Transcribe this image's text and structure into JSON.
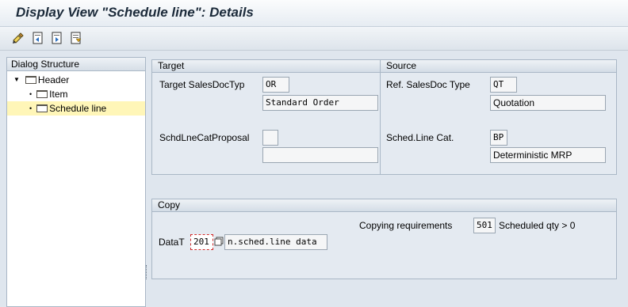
{
  "window": {
    "title": "Display View \"Schedule line\": Details"
  },
  "toolbar": {
    "buttons": [
      {
        "icon": "display-change-icon"
      },
      {
        "icon": "previous-entry-icon"
      },
      {
        "icon": "next-entry-icon"
      },
      {
        "icon": "other-entry-icon"
      }
    ]
  },
  "dialog_structure": {
    "header": "Dialog Structure",
    "items": [
      {
        "label": "Header",
        "level": 0,
        "expanded": true
      },
      {
        "label": "Item",
        "level": 1
      },
      {
        "label": "Schedule line",
        "level": 1,
        "selected": true
      }
    ]
  },
  "target": {
    "title": "Target",
    "target_salesdoctyp_label": "Target SalesDocTyp",
    "target_salesdoctyp_value": "OR",
    "target_salesdoctyp_desc": "Standard Order",
    "schdlnecatproposal_label": "SchdLneCatProposal",
    "schdlnecatproposal_value": "",
    "schdlnecatproposal_desc": ""
  },
  "source": {
    "title": "Source",
    "ref_salesdoc_type_label": "Ref. SalesDoc Type",
    "ref_salesdoc_type_value": "QT",
    "ref_salesdoc_type_desc": "Quotation",
    "sched_line_cat_label": "Sched.Line Cat.",
    "sched_line_cat_value": "BP",
    "sched_line_cat_desc": "Deterministic MRP"
  },
  "copy": {
    "title": "Copy",
    "copying_requirements_label": "Copying requirements",
    "copying_requirements_value": "501",
    "copying_requirements_desc": "Scheduled qty > 0",
    "datat_label": "DataT",
    "datat_value": "201",
    "datat_desc": "n.sched.line data"
  }
}
